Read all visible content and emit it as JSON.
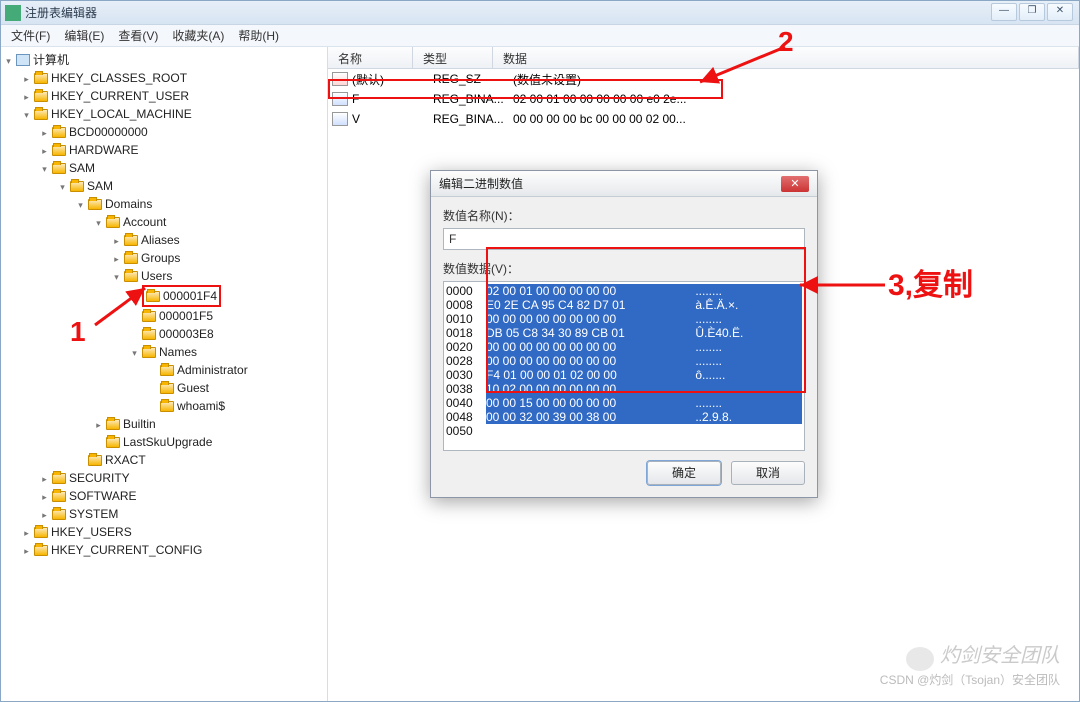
{
  "window": {
    "title": "注册表编辑器"
  },
  "menu": {
    "file": "文件(F)",
    "edit": "编辑(E)",
    "view": "查看(V)",
    "fav": "收藏夹(A)",
    "help": "帮助(H)"
  },
  "tree": {
    "root": "计算机",
    "hkcr": "HKEY_CLASSES_ROOT",
    "hkcu": "HKEY_CURRENT_USER",
    "hklm": "HKEY_LOCAL_MACHINE",
    "bcd": "BCD00000000",
    "hw": "HARDWARE",
    "sam": "SAM",
    "sam2": "SAM",
    "domains": "Domains",
    "account": "Account",
    "aliases": "Aliases",
    "groups": "Groups",
    "users": "Users",
    "u1": "000001F4",
    "u2": "000001F5",
    "u3": "000003E8",
    "names": "Names",
    "admin": "Administrator",
    "guest": "Guest",
    "whoami": "whoami$",
    "builtin": "Builtin",
    "lastsku": "LastSkuUpgrade",
    "rxact": "RXACT",
    "security": "SECURITY",
    "software": "SOFTWARE",
    "system": "SYSTEM",
    "hku": "HKEY_USERS",
    "hkcc": "HKEY_CURRENT_CONFIG"
  },
  "cols": {
    "name": "名称",
    "type": "类型",
    "data": "数据"
  },
  "rows": [
    {
      "name": "(默认)",
      "type": "REG_SZ",
      "data": "(数值未设置)",
      "icon": "str"
    },
    {
      "name": "F",
      "type": "REG_BINA...",
      "data": "02 00 01 00 00 00 00 00 e0 2e...",
      "icon": "bin"
    },
    {
      "name": "V",
      "type": "REG_BINA...",
      "data": "00 00 00 00 bc 00 00 00 02 00...",
      "icon": "bin"
    }
  ],
  "dialog": {
    "title": "编辑二进制数值",
    "name_label": "数值名称(N)：",
    "name_value": "F",
    "data_label": "数值数据(V)：",
    "ok": "确定",
    "cancel": "取消"
  },
  "hex": [
    {
      "off": "0000",
      "b": "02 00 01 00 00 00 00 00",
      "a": "........"
    },
    {
      "off": "0008",
      "b": "E0 2E CA 95 C4 82 D7 01",
      "a": "à.Ê.Ä.×."
    },
    {
      "off": "0010",
      "b": "00 00 00 00 00 00 00 00",
      "a": "........"
    },
    {
      "off": "0018",
      "b": "DB 05 C8 34 30 89 CB 01",
      "a": "Û.È40.Ë."
    },
    {
      "off": "0020",
      "b": "00 00 00 00 00 00 00 00",
      "a": "........"
    },
    {
      "off": "0028",
      "b": "00 00 00 00 00 00 00 00",
      "a": "........"
    },
    {
      "off": "0030",
      "b": "F4 01 00 00 01 02 00 00",
      "a": "ô......."
    },
    {
      "off": "0038",
      "b": "10 02 00 00 00 00 00 00",
      "a": "........"
    },
    {
      "off": "0040",
      "b": "00 00 15 00 00 00 00 00",
      "a": "........"
    },
    {
      "off": "0048",
      "b": "00 00 32 00 39 00 38 00",
      "a": "..2.9.8."
    },
    {
      "off": "0050",
      "b": "",
      "a": ""
    }
  ],
  "ann": {
    "n1": "1",
    "n2": "2",
    "n3": "3,复制"
  },
  "wm": {
    "line1": "灼剑安全团队",
    "line2": "CSDN @灼剑（Tsojan）安全团队"
  }
}
